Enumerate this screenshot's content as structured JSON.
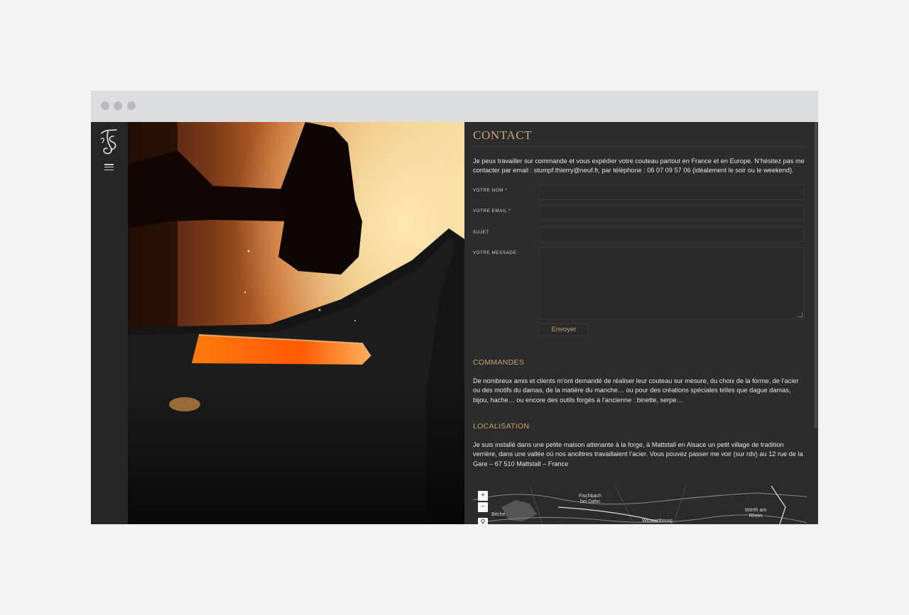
{
  "contact": {
    "heading": "Contact",
    "intro": "Je peux travailler sur commande et vous expédier votre couteau partout en France et en Europe. N’hésitez pas me contacter par email : stumpf.thierry@neuf.fr, par téléphone : 06 07 09 57 06 (idéalement le soir ou le weekend).",
    "form": {
      "name_label": "Votre nom *",
      "email_label": "Votre email *",
      "subject_label": "Sujet",
      "message_label": "Votre message",
      "submit_label": "Envoyer"
    }
  },
  "commandes": {
    "heading": "Commandes",
    "text": "De nombreux amis et clients m’ont demandé de réaliser leur couteau sur mesure, du choix de la forme, de l’acier ou des motifs du damas, de la matière du manche… ou pour des créations spéciales telles que dague damas, bijou, hache… ou encore des outils forgés à l’ancienne : binette, serpe…"
  },
  "localisation": {
    "heading": "Localisation",
    "text": "Je suis installé dans une petite maison attenante à la forge, à Mattstall en Alsace un petit village de tradition verrière, dans une vallée où nos ancêtres travaillaient l’acier. Vous pouvez passer me voir (sur rdv) au 12 rue de la Gare – 67 510 Mattstall – France"
  },
  "map": {
    "zoom_in": "+",
    "zoom_out": "−",
    "labels": {
      "bitche": "Bitche",
      "fischbach": "Fischbach bei Dahn",
      "wissembourg": "Wissembourg",
      "worth": "Wörth am Rhein"
    }
  },
  "colors": {
    "accent": "#c9a27b",
    "panel": "#2c2c2c",
    "sidebar": "#262626",
    "page_bg": "#f3f3f3"
  },
  "icons": {
    "logo": "ts-monogram",
    "menu": "hamburger-icon",
    "search": "search-icon"
  }
}
